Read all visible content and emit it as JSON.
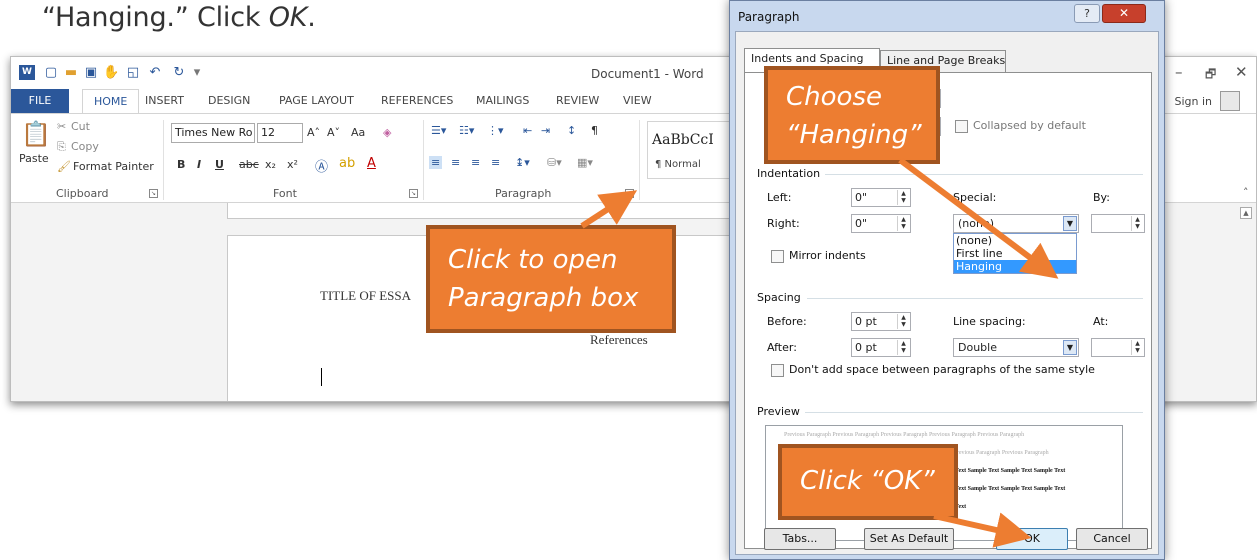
{
  "instruction": {
    "text_part1": "“Hanging.” Click ",
    "text_em": "OK",
    "text_part2": "."
  },
  "word": {
    "window_title": "Document1 - Word",
    "tabs": [
      "FILE",
      "HOME",
      "INSERT",
      "DESIGN",
      "PAGE LAYOUT",
      "REFERENCES",
      "MAILINGS",
      "REVIEW",
      "VIEW"
    ],
    "active_tab": "HOME",
    "sign_in": "Sign in",
    "clipboard": {
      "cut": "Cut",
      "copy": "Copy",
      "paste": "Paste",
      "format_painter": "Format Painter",
      "label": "Clipboard"
    },
    "font": {
      "name": "Times New Ro",
      "size": "12",
      "label": "Font",
      "aa": "Aa",
      "buttons": [
        "B",
        "I",
        "U",
        "abc",
        "x₂",
        "x²"
      ]
    },
    "paragraph": {
      "label": "Paragraph"
    },
    "styles": {
      "sample": "AaBbCcI",
      "sample2": "Aa",
      "normal": "¶ Normal",
      "normal2": "¶ N"
    },
    "document": {
      "title_text": "TITLE OF ESSA",
      "references_text": "References"
    }
  },
  "dialog": {
    "title": "Paragraph",
    "help": "?",
    "close": "✕",
    "tabs": [
      "Indents and Spacing",
      "Line and Page Breaks"
    ],
    "collapsed_label": "Collapsed by default",
    "indentation": {
      "heading": "Indentation",
      "left_label": "Left:",
      "left_value": "0\"",
      "right_label": "Right:",
      "right_value": "0\"",
      "special_label": "Special:",
      "special_value": "(none)",
      "by_label": "By:",
      "mirror_label": "Mirror indents",
      "special_options": [
        "(none)",
        "First line",
        "Hanging"
      ],
      "special_highlighted": "Hanging"
    },
    "spacing": {
      "heading": "Spacing",
      "before_label": "Before:",
      "before_value": "0 pt",
      "after_label": "After:",
      "after_value": "0 pt",
      "line_spacing_label": "Line spacing:",
      "line_spacing_value": "Double",
      "at_label": "At:",
      "dont_add_label": "Don't add space between paragraphs of the same style"
    },
    "preview": {
      "heading": "Preview",
      "previous_line": "Previous Paragraph Previous Paragraph Previous Paragraph Previous Paragraph Previous Paragraph",
      "previous_line_2": "ph Previous Paragraph Previous Paragraph",
      "sample_line": "ple Text Sample Text Sample Text Sample Text",
      "sample_line_short": "ple Text"
    },
    "buttons": {
      "tabs": "Tabs...",
      "set_default": "Set As Default",
      "ok": "OK",
      "cancel": "Cancel"
    }
  },
  "callouts": {
    "choose_line1": "Choose",
    "choose_line2": "“Hanging”",
    "open_line1": "Click to open",
    "open_line2": "Paragraph box",
    "ok": "Click “OK”"
  },
  "colors": {
    "accent_orange": "#ed7d31",
    "word_blue": "#2b579a",
    "dialog_frame": "#c8d8ee",
    "selection_blue": "#3399ff"
  }
}
